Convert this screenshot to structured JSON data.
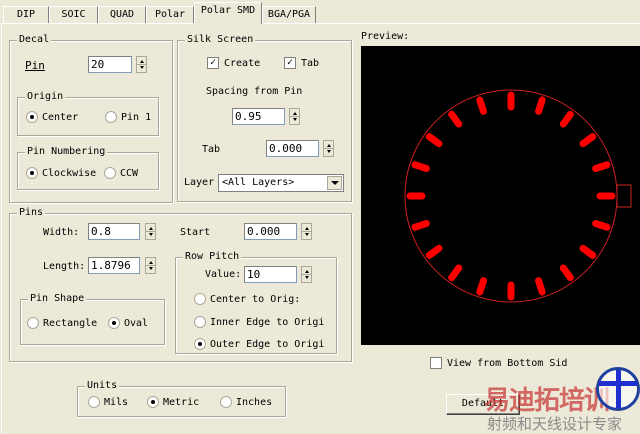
{
  "tabs": [
    "DIP",
    "SOIC",
    "QUAD",
    "Polar",
    "Polar SMD",
    "BGA/PGA"
  ],
  "active_tab": "Polar SMD",
  "decal": {
    "title": "Decal",
    "pin_label": "Pin",
    "pin_value": "20",
    "origin": {
      "title": "Origin",
      "options": [
        "Center",
        "Pin 1"
      ],
      "selected": "Center"
    },
    "numbering": {
      "title": "Pin Numbering",
      "options": [
        "Clockwise",
        "CCW"
      ],
      "selected": "Clockwise"
    }
  },
  "silk": {
    "title": "Silk Screen",
    "create_label": "Create",
    "create_checked": true,
    "tab_label": "Tab",
    "tab_checked": true,
    "spacing_label": "Spacing from Pin",
    "spacing_value": "0.95",
    "tab_field_label": "Tab",
    "tab_value": "0.000",
    "layer_label": "Layer",
    "layer_value": "<All Layers>"
  },
  "pins": {
    "title": "Pins",
    "width_label": "Width:",
    "width_value": "0.8",
    "start_label": "Start",
    "start_value": "0.000",
    "length_label": "Length:",
    "length_value": "1.8796",
    "shape": {
      "title": "Pin Shape",
      "options": [
        "Rectangle",
        "Oval"
      ],
      "selected": "Oval"
    },
    "row_pitch": {
      "title": "Row Pitch",
      "value_label": "Value:",
      "value": "10",
      "options": [
        "Center to Orig:",
        "Inner Edge to Origi",
        "Outer Edge to Origi"
      ],
      "selected": "Outer Edge to Origi"
    }
  },
  "units": {
    "title": "Units",
    "options": [
      "Mils",
      "Metric",
      "Inches"
    ],
    "selected": "Metric"
  },
  "preview": {
    "label": "Preview:",
    "pin_count": 20,
    "pin_color": "#ff0000",
    "outline_color": "#cc2020",
    "background": "#000000"
  },
  "view_bottom": {
    "label": "View from Bottom Sid",
    "checked": false
  },
  "default_button": "Default",
  "watermark": {
    "title": "易迪拓培训",
    "subtitle": "射频和天线设计专家"
  }
}
